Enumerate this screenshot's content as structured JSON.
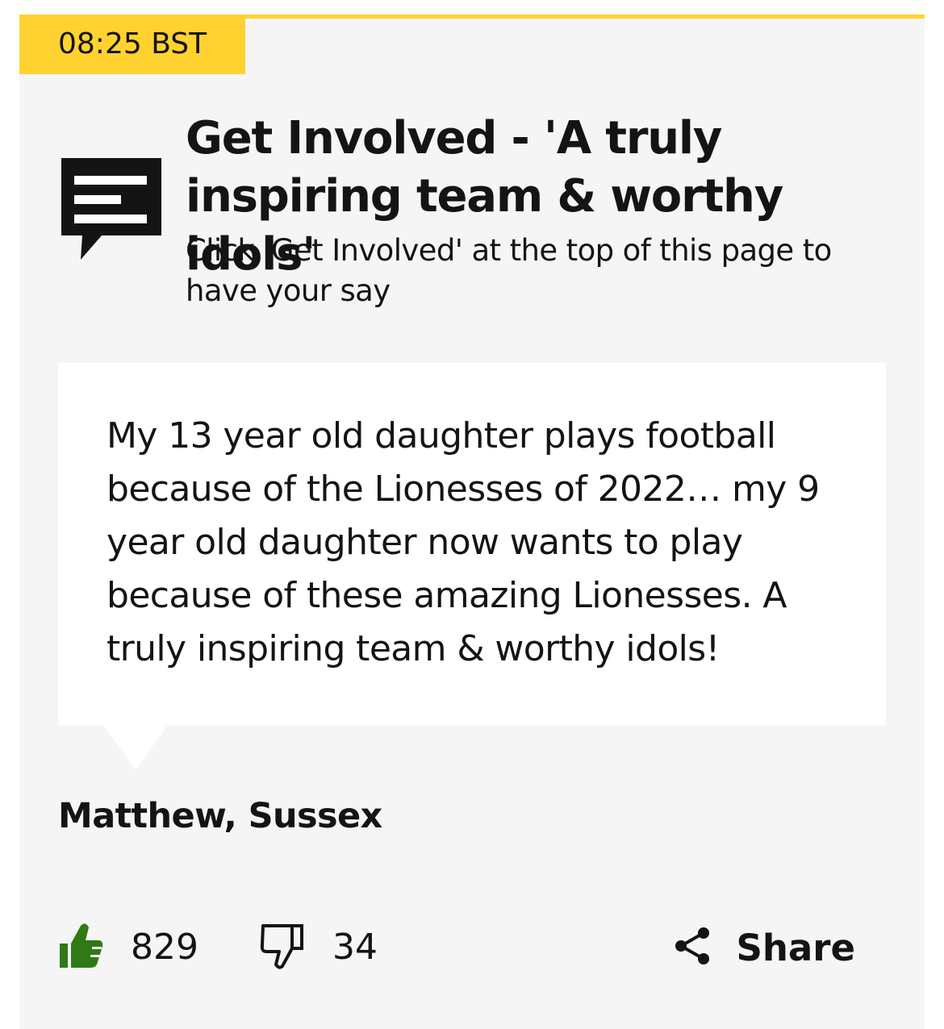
{
  "post": {
    "time": "08:25 BST",
    "title": "Get Involved - 'A truly inspiring team & worthy idols'",
    "subtitle": "Click 'Get Involved' at the top of this page to have your say",
    "quote": "My 13 year old daughter plays football because of the Lionesses of 2022… my 9 year old daughter now wants to play because of these amazing Lionesses. A truly inspiring team & worthy idols!",
    "author": "Matthew, Sussex",
    "icon": "comment-speech-bubble-icon"
  },
  "reactions": {
    "likes": "829",
    "dislikes": "34",
    "share_label": "Share",
    "like_icon": "thumbs-up-icon",
    "dislike_icon": "thumbs-down-icon",
    "share_icon": "share-icon"
  },
  "colors": {
    "accent": "#ffd230",
    "card_background": "#f5f5f5",
    "like_green": "#2f7a14",
    "text": "#141414"
  }
}
